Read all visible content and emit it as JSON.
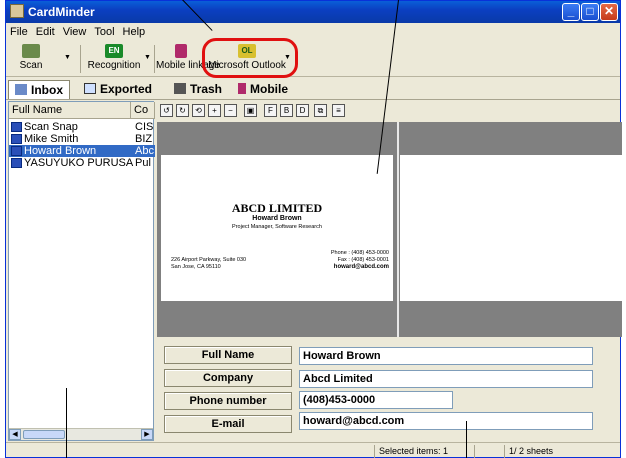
{
  "window": {
    "title": "CardMinder"
  },
  "menu": [
    "File",
    "Edit",
    "View",
    "Tool",
    "Help"
  ],
  "toolbar": {
    "scan": "Scan",
    "recognition": "Recognition",
    "recognition_icon_text": "EN",
    "mobile_linkage": "Mobile linkage",
    "outlook": "Microsoft Outlook",
    "outlook_icon_text": "OL"
  },
  "tabs": [
    "Inbox",
    "Exported",
    "Trash",
    "Mobile"
  ],
  "list": {
    "headers": [
      "Full Name",
      "Co"
    ],
    "rows": [
      {
        "name": "Scan Snap",
        "company": "CIS"
      },
      {
        "name": "Mike Smith",
        "company": "BIZ"
      },
      {
        "name": "Howard Brown",
        "company": "Abc"
      },
      {
        "name": "YASUYUKO PURUSA",
        "company": "Pul"
      }
    ],
    "selected": 2
  },
  "card": {
    "company": "ABCD LIMITED",
    "name": "Howard Brown",
    "title": "Project Manager, Software Research",
    "address_line1": "226 Airport Parkway, Suite 030",
    "address_line2": "San Jose, CA 95110",
    "phone": "Phone : (408) 453-0000",
    "fax": "Fax : (408) 453-0001",
    "email": "howard@abcd.com"
  },
  "form": {
    "full_name_label": "Full Name",
    "full_name_value": "Howard Brown",
    "company_label": "Company",
    "company_value": "Abcd Limited",
    "phone_label": "Phone number",
    "phone_value": "(408)453-0000",
    "email_label": "E-mail",
    "email_value": "howard@abcd.com"
  },
  "status": {
    "selected_items": "Selected items:   1",
    "pages": "1/    2 sheets"
  },
  "colors": {
    "highlight": "#e01010",
    "titlebar": "#0a5fd8",
    "selection": "#316ac5"
  }
}
